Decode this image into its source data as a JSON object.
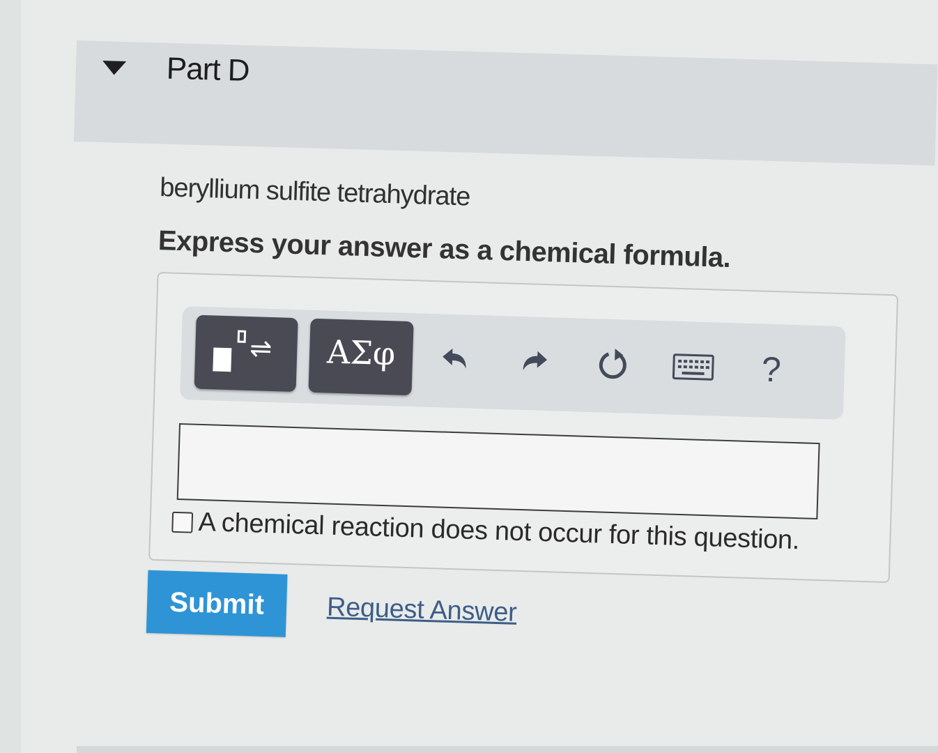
{
  "part": {
    "title": "Part D"
  },
  "question": {
    "prompt": "beryllium sulfite tetrahydrate",
    "instruction": "Express your answer as a chemical formula."
  },
  "toolbar": {
    "greek_label": "ΑΣφ",
    "help_label": "?",
    "icons": [
      "templates-icon",
      "undo-icon",
      "redo-icon",
      "reset-icon",
      "keyboard-icon",
      "help-icon"
    ]
  },
  "answer": {
    "value": "",
    "no_reaction_label": "A chemical reaction does not occur for this question.",
    "no_reaction_checked": false
  },
  "actions": {
    "submit_label": "Submit",
    "request_answer_label": "Request Answer"
  },
  "colors": {
    "submit_blue": "#2e94d6",
    "link_blue": "#3d5d86",
    "toolbar_button_dark": "#4a4a55"
  }
}
